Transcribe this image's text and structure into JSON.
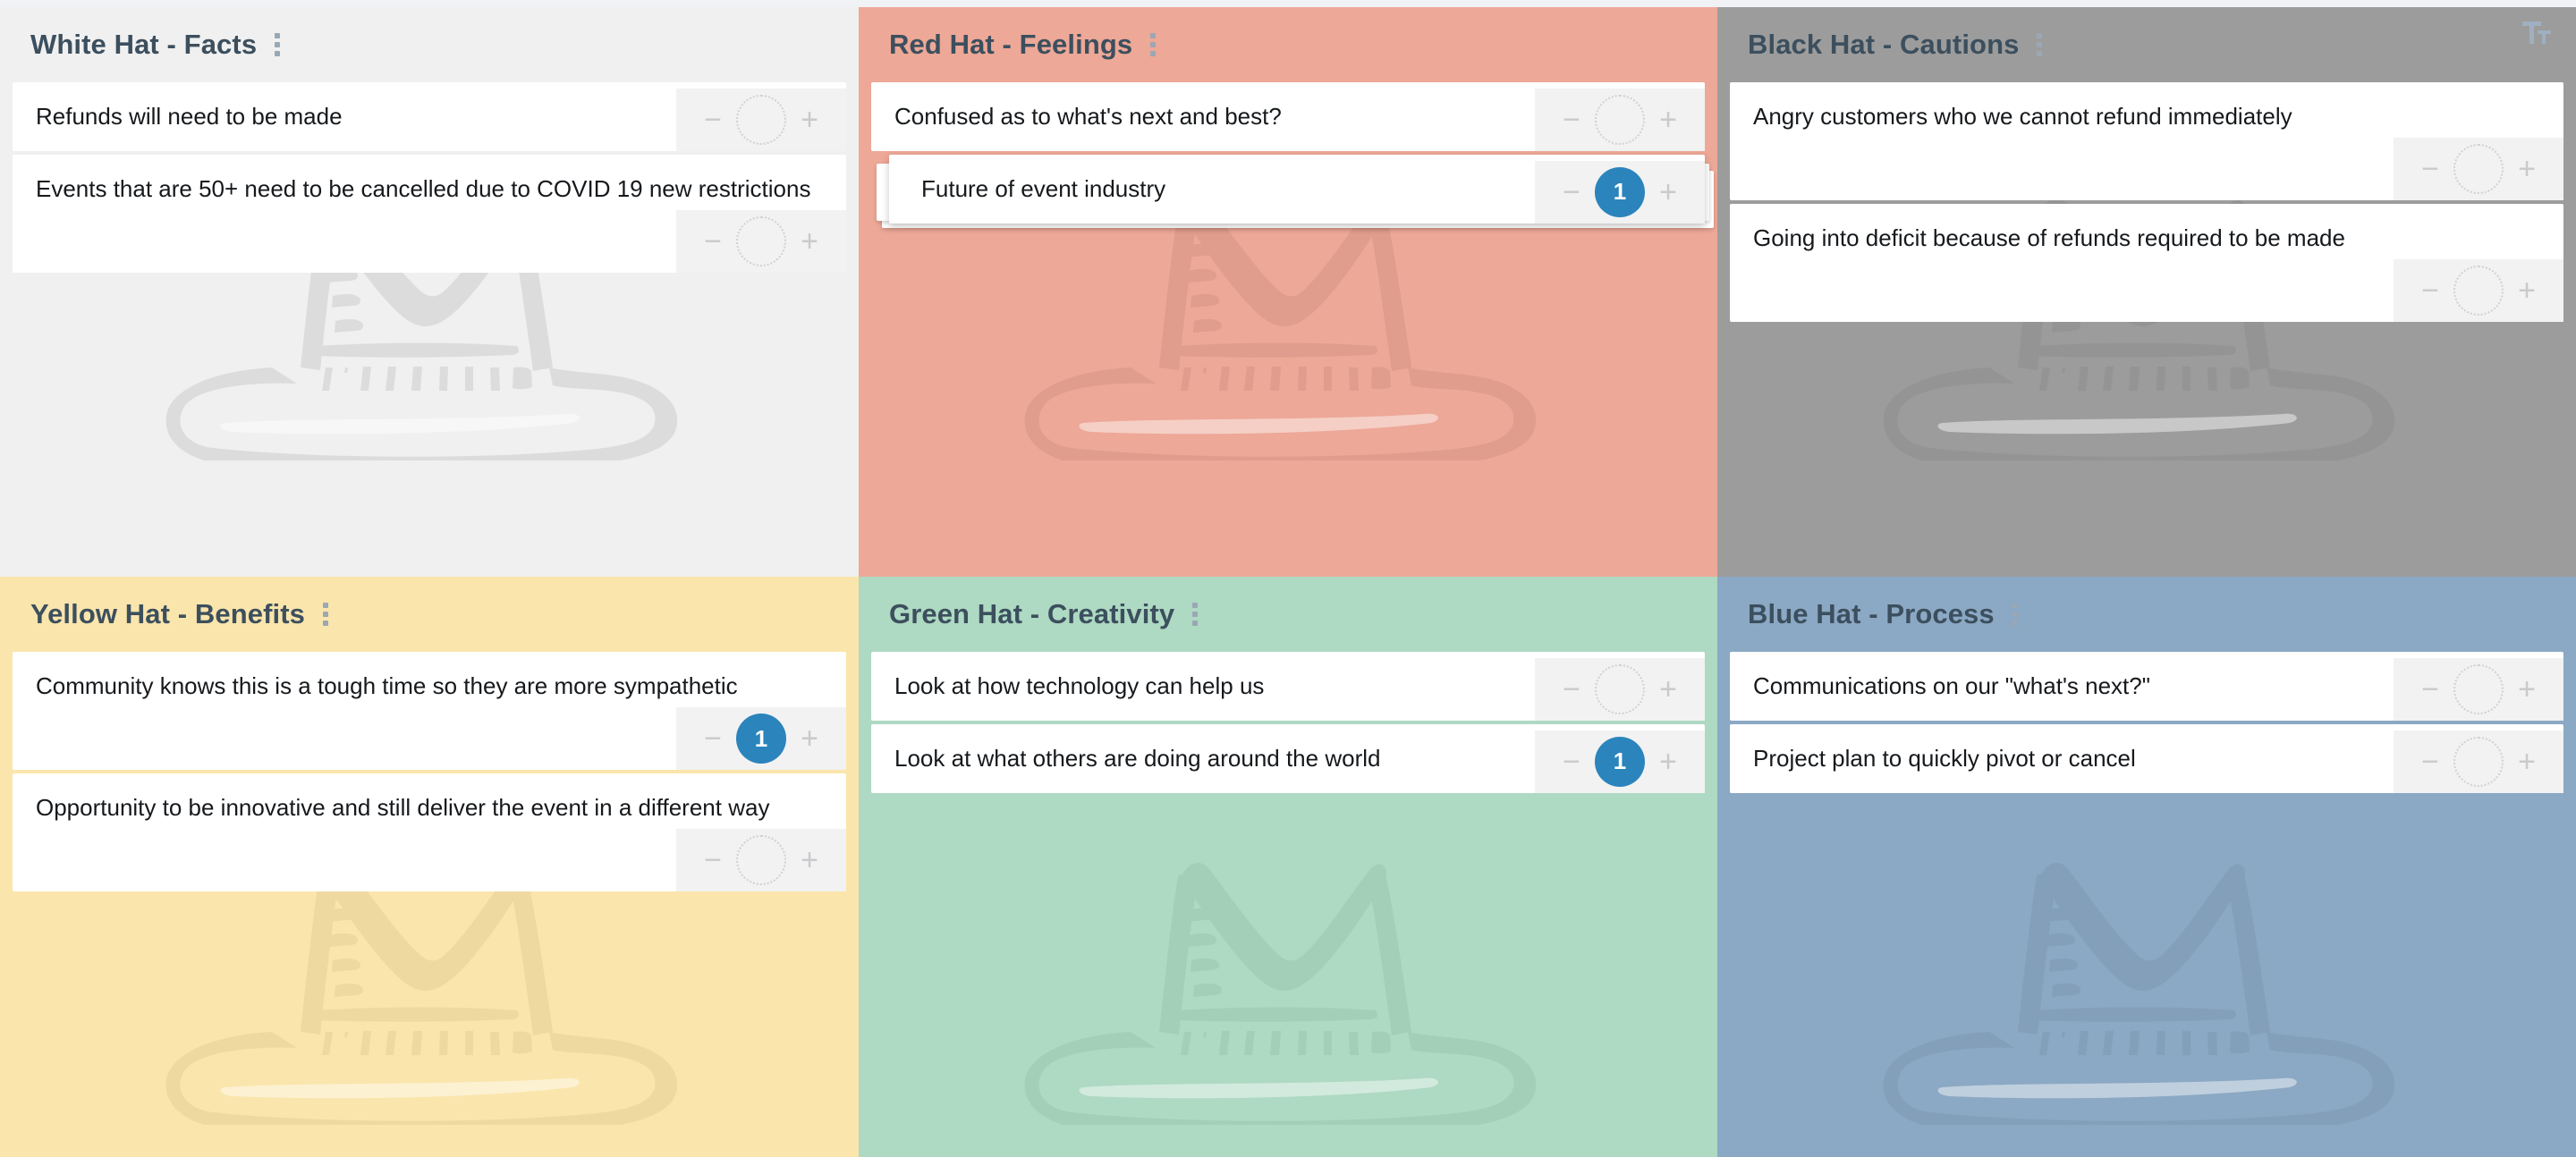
{
  "board": {
    "type": "six-thinking-hats-retrospective",
    "background_color": "#f1f2f5",
    "accent_vote_color": "#2b84bc",
    "title_color": "#3c4f5e"
  },
  "toolbar": {
    "text_size_icon": "text-size-icon",
    "text_size_label": "Tt"
  },
  "icons": {
    "kebab_menu": "kebab-menu-icon",
    "vote_minus": "−",
    "vote_plus": "+",
    "hat_watermark": "top-hat-watermark-icon"
  },
  "columns": [
    {
      "id": "white-hat",
      "title": "White Hat - Facts",
      "background_color": "#f0f0f0",
      "watermark_color": "#dcdcdc",
      "menu_label": "column-menu",
      "cards": [
        {
          "text": "Refunds will need to be made",
          "votes": 0,
          "vote_display": "",
          "tall": false,
          "dragging": false
        },
        {
          "text": "Events that are 50+ need to be cancelled due to COVID 19 new restrictions",
          "votes": 0,
          "vote_display": "",
          "tall": true,
          "dragging": false
        }
      ]
    },
    {
      "id": "red-hat",
      "title": "Red Hat - Feelings",
      "background_color": "#eda897",
      "watermark_color": "#e09c8c",
      "menu_label": "column-menu",
      "cards": [
        {
          "text": "Confused as to what's next and best?",
          "votes": 0,
          "vote_display": "",
          "tall": false,
          "dragging": false
        },
        {
          "text": "Future of event industry",
          "votes": 1,
          "vote_display": "1",
          "tall": false,
          "dragging": true
        }
      ]
    },
    {
      "id": "black-hat",
      "title": "Black Hat - Cautions",
      "background_color": "#9c9c9c",
      "watermark_color": "#949494",
      "menu_label": "column-menu",
      "cards": [
        {
          "text": "Angry customers who we cannot refund immediately",
          "votes": 0,
          "vote_display": "",
          "tall": true,
          "dragging": false
        },
        {
          "text": "Going into deficit because of refunds required to be made",
          "votes": 0,
          "vote_display": "",
          "tall": true,
          "dragging": false
        }
      ]
    },
    {
      "id": "yellow-hat",
      "title": "Yellow Hat - Benefits",
      "background_color": "#fae5ac",
      "watermark_color": "#eed9a0",
      "menu_label": "column-menu",
      "cards": [
        {
          "text": "Community knows this is a tough time so they are more sympathetic",
          "votes": 1,
          "vote_display": "1",
          "tall": true,
          "dragging": false
        },
        {
          "text": "Opportunity to be innovative and still deliver the event in a different way",
          "votes": 0,
          "vote_display": "",
          "tall": true,
          "dragging": false
        }
      ]
    },
    {
      "id": "green-hat",
      "title": "Green Hat - Creativity",
      "background_color": "#aed9c2",
      "watermark_color": "#a3cfb8",
      "menu_label": "column-menu",
      "cards": [
        {
          "text": "Look at how technology can help us",
          "votes": 0,
          "vote_display": "",
          "tall": false,
          "dragging": false
        },
        {
          "text": "Look at what others are doing around the world",
          "votes": 1,
          "vote_display": "1",
          "tall": false,
          "dragging": false
        }
      ]
    },
    {
      "id": "blue-hat",
      "title": "Blue Hat - Process",
      "background_color": "#8ba8c4",
      "watermark_color": "#839fba",
      "menu_label": "column-menu",
      "cards": [
        {
          "text": "Communications on our \"what's next?\"",
          "votes": 0,
          "vote_display": "",
          "tall": false,
          "dragging": false
        },
        {
          "text": "Project plan to quickly pivot or cancel",
          "votes": 0,
          "vote_display": "",
          "tall": false,
          "dragging": false
        }
      ]
    }
  ]
}
